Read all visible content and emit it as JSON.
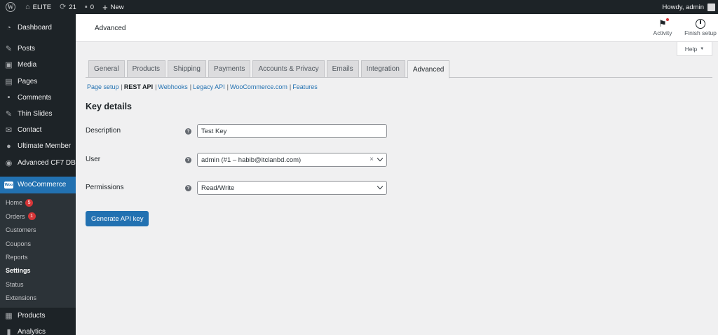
{
  "adminbar": {
    "site_name": "ELITE",
    "updates_count": "21",
    "comments_count": "0",
    "new_label": "New",
    "howdy": "Howdy, admin",
    "icons": {
      "wp": "wordpress-logo-icon",
      "home": "home-icon",
      "updates": "refresh-icon",
      "comments": "comment-bubble-icon",
      "new": "plus-icon"
    }
  },
  "sidebar": {
    "top_items": [
      {
        "label": "Dashboard",
        "icon": "dashboard-icon"
      },
      {
        "label": "Posts",
        "icon": "pin-icon"
      },
      {
        "label": "Media",
        "icon": "media-icon"
      },
      {
        "label": "Pages",
        "icon": "pages-icon"
      },
      {
        "label": "Comments",
        "icon": "comment-icon"
      },
      {
        "label": "Thin Slides",
        "icon": "pin-icon"
      },
      {
        "label": "Contact",
        "icon": "envelope-icon"
      },
      {
        "label": "Ultimate Member",
        "icon": "user-icon"
      },
      {
        "label": "Advanced CF7 DB",
        "icon": "eye-icon"
      }
    ],
    "woocommerce": {
      "label": "WooCommerce",
      "badge": "Woo"
    },
    "submenu": [
      {
        "label": "Home",
        "count": "5"
      },
      {
        "label": "Orders",
        "count": "1"
      },
      {
        "label": "Customers"
      },
      {
        "label": "Coupons"
      },
      {
        "label": "Reports"
      },
      {
        "label": "Settings"
      },
      {
        "label": "Status"
      },
      {
        "label": "Extensions"
      }
    ],
    "bottom_items": [
      {
        "label": "Products",
        "icon": "box-icon"
      },
      {
        "label": "Analytics",
        "icon": "bar-chart-icon"
      }
    ]
  },
  "header": {
    "title": "Advanced",
    "activity_label": "Activity",
    "finish_setup_label": "Finish setup",
    "help_label": "Help"
  },
  "tabs": [
    "General",
    "Products",
    "Shipping",
    "Payments",
    "Accounts & Privacy",
    "Emails",
    "Integration",
    "Advanced"
  ],
  "active_tab": "Advanced",
  "subnav": [
    "Page setup",
    "REST API",
    "Webhooks",
    "Legacy API",
    "WooCommerce.com",
    "Features"
  ],
  "active_subnav": "REST API",
  "form": {
    "section_title": "Key details",
    "description": {
      "label": "Description",
      "value": "Test Key"
    },
    "user": {
      "label": "User",
      "value": "admin (#1 – habib@itclanbd.com)"
    },
    "permissions": {
      "label": "Permissions",
      "value": "Read/Write"
    },
    "submit_label": "Generate API key"
  },
  "colors": {
    "accent": "#2271b1",
    "sidebar_bg": "#1d2327",
    "badge_red": "#d63638"
  }
}
